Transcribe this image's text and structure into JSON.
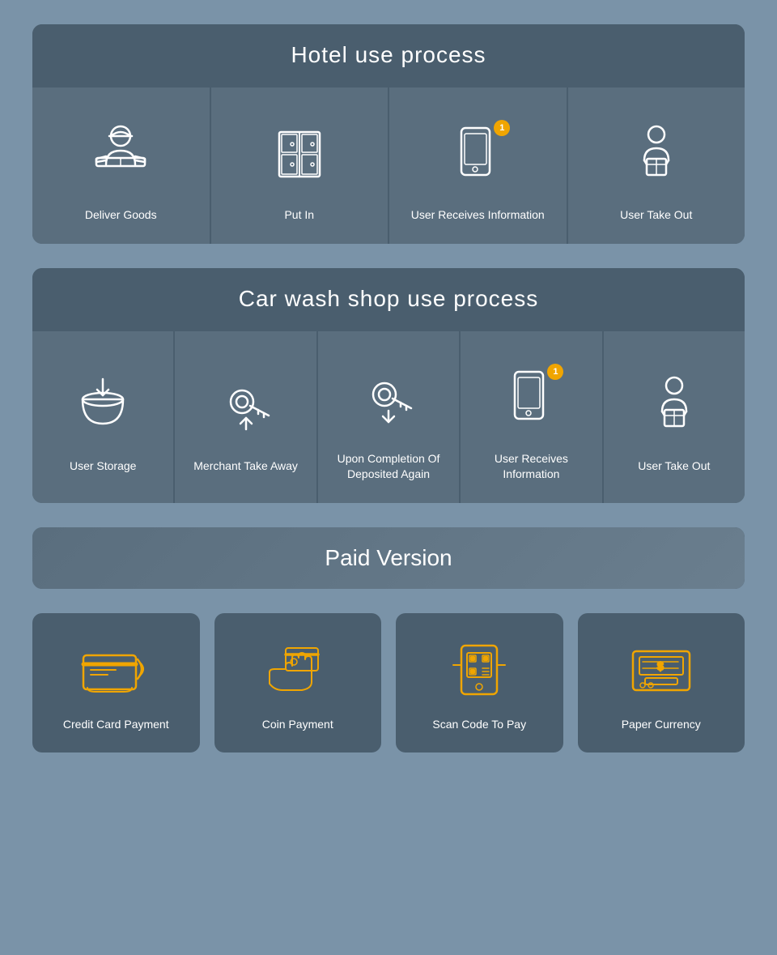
{
  "hotel": {
    "title": "Hotel use process",
    "items": [
      {
        "label": "Deliver Goods",
        "icon": "deliver"
      },
      {
        "label": "Put In",
        "icon": "locker"
      },
      {
        "label": "User Receives Information",
        "icon": "phone-notify"
      },
      {
        "label": "User Take Out",
        "icon": "user-box"
      }
    ]
  },
  "carwash": {
    "title": "Car wash shop use process",
    "items": [
      {
        "label": "User Storage",
        "icon": "storage"
      },
      {
        "label": "Merchant Take Away",
        "icon": "key-up"
      },
      {
        "label": "Upon Completion Of Deposited Again",
        "icon": "key-down"
      },
      {
        "label": "User Receives Information",
        "icon": "phone-notify2"
      },
      {
        "label": "User Take Out",
        "icon": "user-box2"
      }
    ]
  },
  "paid": {
    "title": "Paid Version",
    "items": [
      {
        "label": "Credit Card Payment",
        "icon": "credit-card"
      },
      {
        "label": "Coin Payment",
        "icon": "coin"
      },
      {
        "label": "Scan Code To Pay",
        "icon": "scan"
      },
      {
        "label": "Paper Currency",
        "icon": "cash"
      }
    ]
  }
}
